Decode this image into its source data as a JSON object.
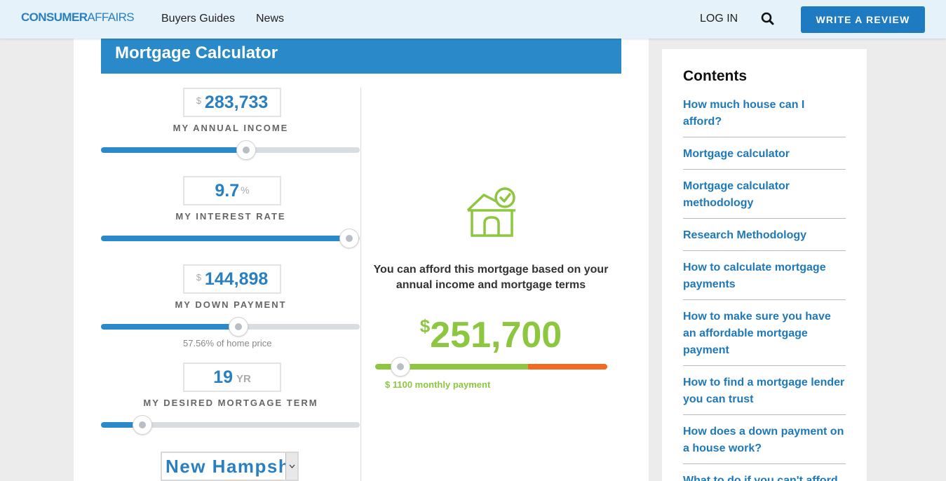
{
  "header": {
    "logo_part1": "CONSUMER",
    "logo_part2": "AFFAIRS",
    "nav": [
      "Buyers Guides",
      "News"
    ],
    "login": "LOG IN",
    "write_review": "WRITE A REVIEW"
  },
  "calculator": {
    "title": "Mortgage Calculator",
    "fields": {
      "income": {
        "prefix": "$",
        "value": "283,733",
        "label": "MY ANNUAL INCOME",
        "slider_fraction": 0.56
      },
      "interest": {
        "value": "9.7",
        "suffix": "%",
        "label": "MY INTEREST RATE",
        "slider_fraction": 0.96
      },
      "down_payment": {
        "prefix": "$",
        "value": "144,898",
        "label": "MY DOWN PAYMENT",
        "slider_fraction": 0.53,
        "note": "57.56% of home price"
      },
      "term": {
        "value": "19",
        "suffix": "YR",
        "label": "MY DESIRED MORTGAGE TERM",
        "slider_fraction": 0.16
      }
    },
    "state": {
      "selected": "New Hampshire"
    },
    "result": {
      "message": "You can afford this mortgage based on your annual income and mortgage terms",
      "currency": "$",
      "amount": "251,700",
      "green_fraction": 0.66,
      "knob_fraction": 0.11,
      "monthly": "$ 1100 monthly payment"
    },
    "colors": {
      "accent": "#2a8ac9",
      "afford_green": "#8dc63f",
      "warning_orange": "#f26b21"
    }
  },
  "sidebar": {
    "title": "Contents",
    "items": [
      "How much house can I afford?",
      "Mortgage calculator",
      "Mortgage calculator methodology",
      "Research Methodology",
      "How to calculate mortgage payments",
      "How to make sure you have an affordable mortgage payment",
      "How to find a mortgage lender you can trust",
      "How does a down payment on a house work?",
      "What to do if you can't afford"
    ]
  }
}
